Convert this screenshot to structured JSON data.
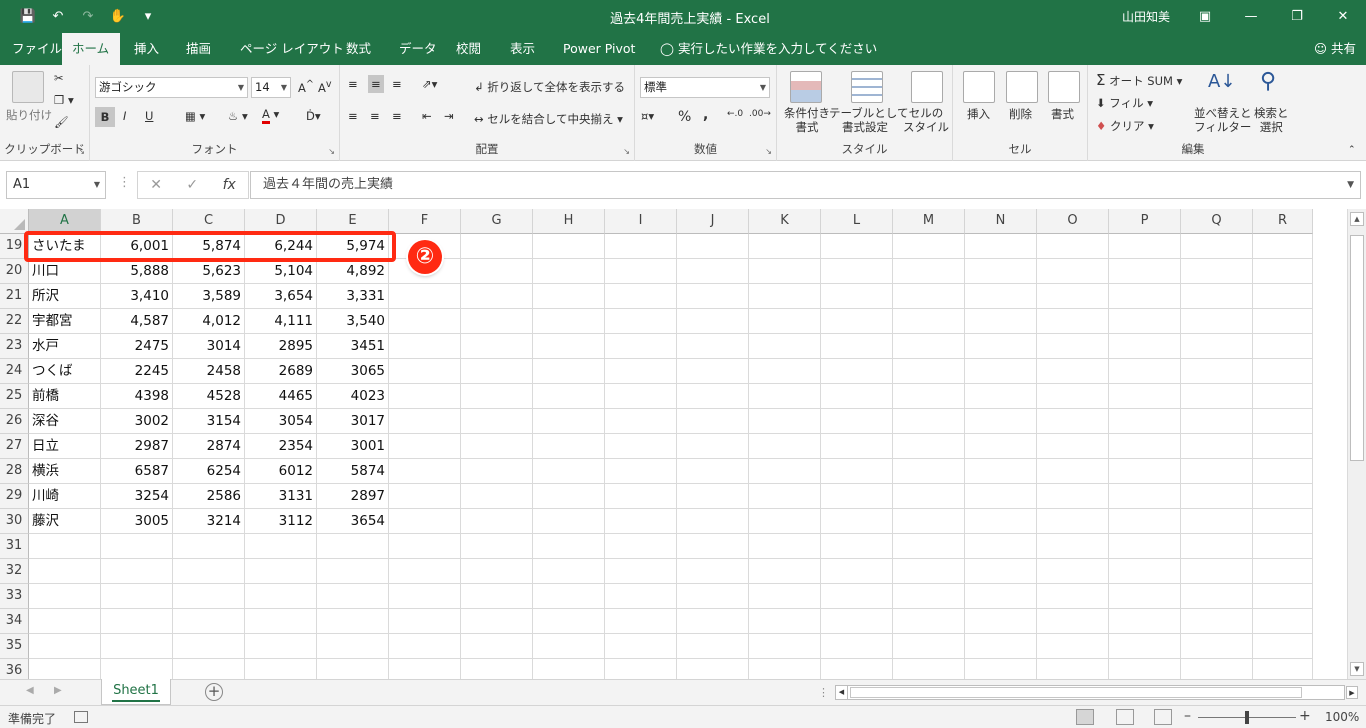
{
  "window": {
    "title": "過去4年間売上実績 - Excel",
    "user": "山田知美",
    "share": "共有"
  },
  "tabs": [
    "ファイル",
    "ホーム",
    "挿入",
    "描画",
    "ページ レイアウト",
    "数式",
    "データ",
    "校閲",
    "表示",
    "Power Pivot",
    "実行したい作業を入力してください"
  ],
  "ribbon": {
    "clipboard": {
      "paste": "貼り付け",
      "label": "クリップボード"
    },
    "font": {
      "name": "游ゴシック",
      "size": "14",
      "bold": "B",
      "italic": "I",
      "underline": "U",
      "color_letter": "A",
      "label": "フォント"
    },
    "alignment": {
      "wrap": "折り返して全体を表示する",
      "merge": "セルを結合して中央揃え",
      "label": "配置"
    },
    "number": {
      "format": "標準",
      "percent": "%",
      "comma": ",",
      "label": "数値"
    },
    "styles": {
      "conditional": [
        "条件付き",
        "書式"
      ],
      "table": [
        "テーブルとして",
        "書式設定"
      ],
      "cell": [
        "セルの",
        "スタイル"
      ],
      "label": "スタイル"
    },
    "cells": {
      "insert": "挿入",
      "delete": "削除",
      "format": "書式",
      "label": "セル"
    },
    "editing": {
      "autosum": "オート SUM",
      "fill": "フィル",
      "clear": "クリア",
      "sort": [
        "並べ替えと",
        "フィルター"
      ],
      "find": [
        "検索と",
        "選択"
      ],
      "label": "編集"
    }
  },
  "formula_bar": {
    "name_box": "A1",
    "fx": "fx",
    "content": "過去４年間の売上実績"
  },
  "columns": [
    "A",
    "B",
    "C",
    "D",
    "E",
    "F",
    "G",
    "H",
    "I",
    "J",
    "K",
    "L",
    "M",
    "N",
    "O",
    "P",
    "Q",
    "R"
  ],
  "rows": [
    {
      "num": "19",
      "cells": [
        "さいたま",
        "6,001",
        "5,874",
        "6,244",
        "5,974"
      ]
    },
    {
      "num": "20",
      "cells": [
        "川口",
        "5,888",
        "5,623",
        "5,104",
        "4,892"
      ]
    },
    {
      "num": "21",
      "cells": [
        "所沢",
        "3,410",
        "3,589",
        "3,654",
        "3,331"
      ]
    },
    {
      "num": "22",
      "cells": [
        "宇都宮",
        "4,587",
        "4,012",
        "4,111",
        "3,540"
      ]
    },
    {
      "num": "23",
      "cells": [
        "水戸",
        "2475",
        "3014",
        "2895",
        "3451"
      ]
    },
    {
      "num": "24",
      "cells": [
        "つくば",
        "2245",
        "2458",
        "2689",
        "3065"
      ]
    },
    {
      "num": "25",
      "cells": [
        "前橋",
        "4398",
        "4528",
        "4465",
        "4023"
      ]
    },
    {
      "num": "26",
      "cells": [
        "深谷",
        "3002",
        "3154",
        "3054",
        "3017"
      ]
    },
    {
      "num": "27",
      "cells": [
        "日立",
        "2987",
        "2874",
        "2354",
        "3001"
      ]
    },
    {
      "num": "28",
      "cells": [
        "横浜",
        "6587",
        "6254",
        "6012",
        "5874"
      ]
    },
    {
      "num": "29",
      "cells": [
        "川崎",
        "3254",
        "2586",
        "3131",
        "2897"
      ]
    },
    {
      "num": "30",
      "cells": [
        "藤沢",
        "3005",
        "3214",
        "3112",
        "3654"
      ]
    },
    {
      "num": "31",
      "cells": []
    },
    {
      "num": "32",
      "cells": []
    },
    {
      "num": "33",
      "cells": []
    },
    {
      "num": "34",
      "cells": []
    },
    {
      "num": "35",
      "cells": []
    },
    {
      "num": "36",
      "cells": []
    }
  ],
  "annotation": {
    "callout": "②",
    "color": "#ff2a12"
  },
  "sheet_tab": "Sheet1",
  "status": {
    "ready": "準備完了",
    "zoom": "100%"
  },
  "colors": {
    "excel_green": "#217346",
    "highlight_red": "#ff2a12"
  }
}
